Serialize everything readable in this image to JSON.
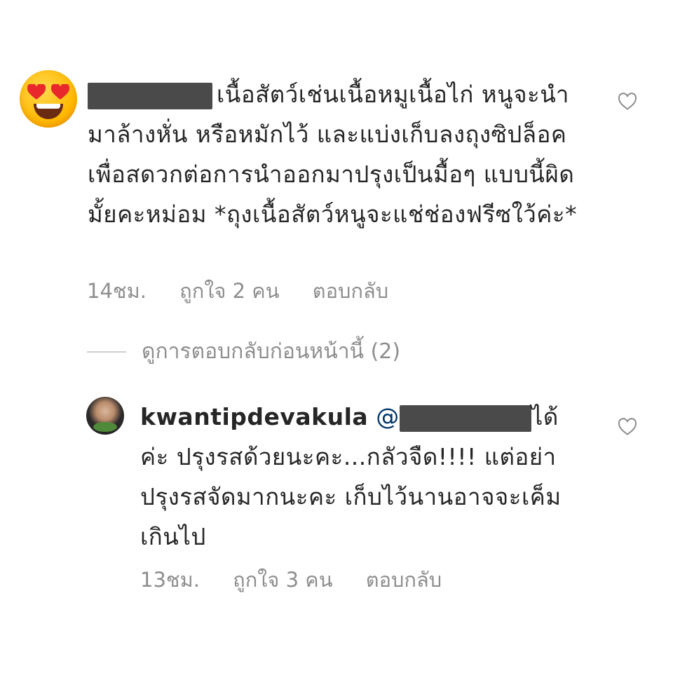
{
  "comment": {
    "avatar_icon": "heart-eyes-emoji",
    "text": "เนื้อสัตว์เช่นเนื้อหมูเนื้อไก่  หนูจะนำมาล้างหั่น หรือหมักไว้  และแบ่งเก็บลงถุงซิปล็อค เพื่อสดวกต่อการนำออกมาปรุงเป็นมื้อๆ  แบบนี้ผิดมั้ยคะหม่อม *ถุงเนื้อสัตว์หนูจะแช่ช่องฟรีซใว้ค่ะ*",
    "time": "14ชม.",
    "likes": "ถูกใจ 2 คน",
    "reply_label": "ตอบกลับ"
  },
  "view_replies": {
    "label": "ดูการตอบกลับก่อนหน้านี้ (2)"
  },
  "reply": {
    "username": "kwantipdevakula",
    "mention_prefix": "@",
    "text": "ได้ค่ะ ปรุงรสด้วยนะคะ...กลัวจืด!!!! แต่อย่าปรุงรสจัดมากนะคะ เก็บไว้นานอาจจะเค็มเกินไป",
    "time": "13ชม.",
    "likes": "ถูกใจ 3 คน",
    "reply_label": "ตอบกลับ"
  },
  "colors": {
    "text": "#262626",
    "meta": "#8e8e8e",
    "mention": "#003569",
    "redaction": "#4a4a4a"
  }
}
